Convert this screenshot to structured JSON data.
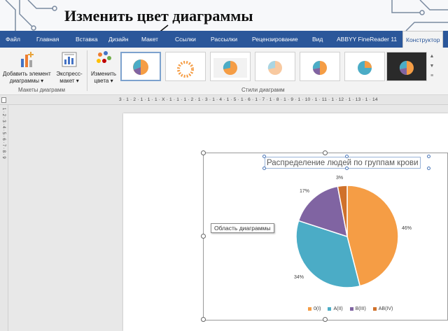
{
  "caption": "Изменить цвет  диаграммы",
  "tabs": [
    {
      "label": "Файл",
      "active": false
    },
    {
      "label": "Главная",
      "active": false
    },
    {
      "label": "Вставка",
      "active": false
    },
    {
      "label": "Дизайн",
      "active": false
    },
    {
      "label": "Макет",
      "active": false
    },
    {
      "label": "Ссылки",
      "active": false
    },
    {
      "label": "Рассылки",
      "active": false
    },
    {
      "label": "Рецензирование",
      "active": false
    },
    {
      "label": "Вид",
      "active": false
    },
    {
      "label": "ABBYY FineReader 11",
      "active": false
    },
    {
      "label": "Конструктор",
      "active": true
    }
  ],
  "ribbon": {
    "add_element_line1": "Добавить элемент",
    "add_element_line2": "диаграммы ▾",
    "express_line1": "Экспресс-",
    "express_line2": "макет ▾",
    "change_color_line1": "Изменить",
    "change_color_line2": "цвета ▾",
    "group_layouts": "Макеты диаграмм",
    "group_styles": "Стили диаграмм"
  },
  "ruler": {
    "numbers": "3 · 1 · 2 · 1 · 1 · 1 · X · 1 · 1 · 1 · 2 · 1 · 3 · 1 · 4 · 1 · 5 · 1 · 6 · 1 · 7 · 1 · 8 · 1 · 9 · 1 · 10 · 1 · 11 · 1 · 12 · 1 · 13 · 1 · 14",
    "vertical": "1 · 2 · 3 · 4 · 5 · 6 · 7 · 8 · 9"
  },
  "tooltip": "Область диаграммы",
  "colors": {
    "ribbon_blue": "#2b579a",
    "slice_0": "#f59d45",
    "slice_a": "#4bacc6",
    "slice_b": "#8064a2",
    "slice_ab": "#d0712a"
  },
  "chart_data": {
    "type": "pie",
    "title": "Распределение людей по группам крови",
    "categories": [
      "0(I)",
      "A(II)",
      "B(III)",
      "AB(IV)"
    ],
    "values": [
      46,
      34,
      17,
      3
    ],
    "labels": [
      "46%",
      "34%",
      "17%",
      "3%"
    ],
    "legend_position": "bottom"
  }
}
